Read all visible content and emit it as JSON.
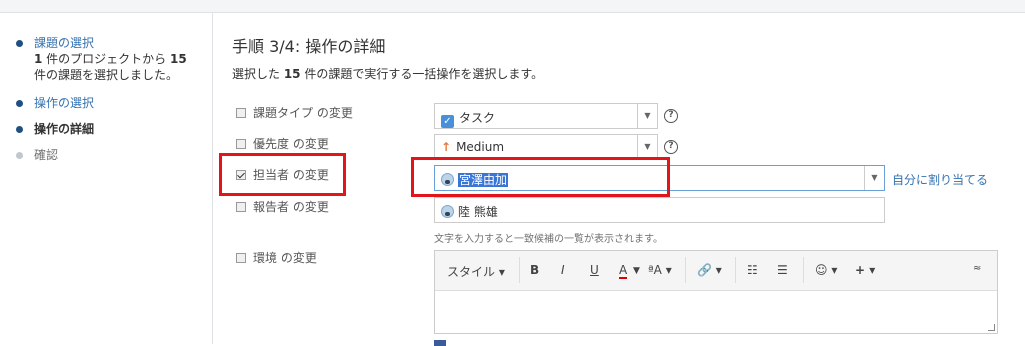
{
  "sidebar": {
    "steps": [
      {
        "label": "課題の選択",
        "detail_line1_num": "1",
        "detail_line1_text": " 件のプロジェクトから ",
        "detail_line1_num2": "15",
        "detail_line2": "件の課題を選択しました。"
      },
      {
        "label": "操作の選択"
      },
      {
        "label": "操作の詳細"
      },
      {
        "label": "確認"
      }
    ]
  },
  "main": {
    "heading": "手順 3/4: 操作の詳細",
    "desc_prefix": "選択した ",
    "desc_count": "15",
    "desc_suffix": " 件の課題で実行する一括操作を選択します。",
    "options": [
      {
        "label": "課題タイプ の変更",
        "checked": false
      },
      {
        "label": "優先度 の変更",
        "checked": false
      },
      {
        "label": "担当者 の変更",
        "checked": true
      },
      {
        "label": "報告者 の変更",
        "checked": false
      },
      {
        "label": "環境 の変更",
        "checked": false
      }
    ],
    "issue_type_value": "タスク",
    "priority_value": "Medium",
    "assignee_value": "宮澤由加",
    "reporter_value": "陸 熊雄",
    "assign_to_me": "自分に割り当てる",
    "hint": "文字を入力すると一致候補の一覧が表示されます。",
    "editor_toolbar": {
      "style_label": "スタイル",
      "bold": "B",
      "italic": "I",
      "underline": "U",
      "text_color": "A",
      "font_size": "ªA"
    },
    "help_glyph": "?"
  },
  "colors": {
    "highlight_box": "#e4141b",
    "link": "#3572b0",
    "selection": "#3875d7"
  }
}
